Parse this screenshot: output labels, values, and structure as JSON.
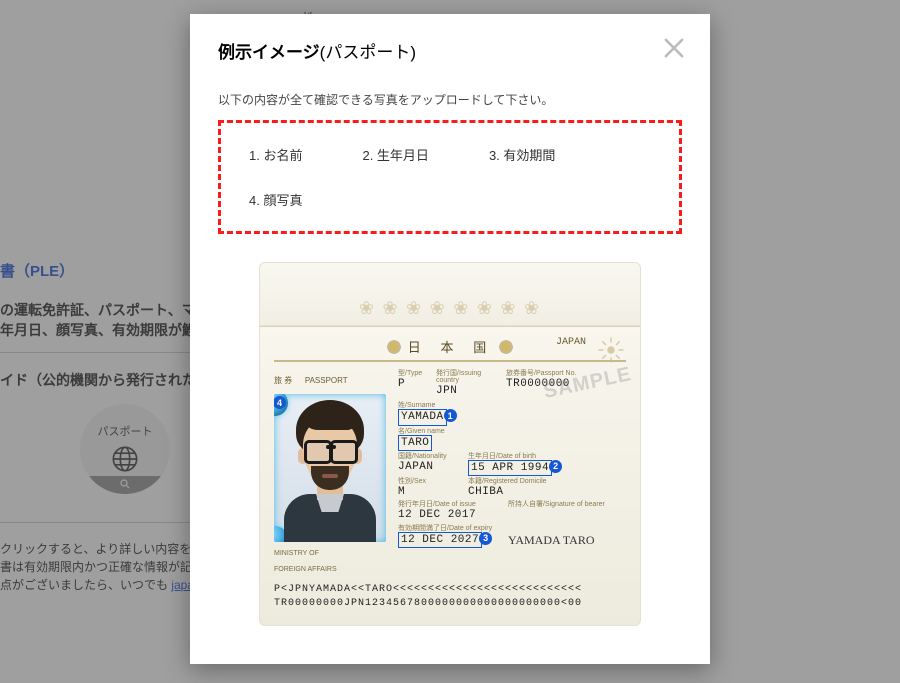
{
  "background": {
    "stock_label": "株",
    "ple_heading": "書（PLE）",
    "line1": "の運転免許証、パスポート、マ",
    "line2": "年月日、顔写真、有効期限が鯉",
    "guide": "イド（公的機関から発行された誰",
    "circle_label": "パスポート",
    "note1": "クリックすると、より詳しい内容を確認することが",
    "note2": "書は有効期限内かつ正確な情報が記載さ",
    "note3_prefix": "点がございましたら、いつでも ",
    "note3_link": "japan.support@"
  },
  "modal": {
    "title_bold": "例示イメージ",
    "title_rest": "(パスポート)",
    "subtitle": "以下の内容が全て確認できる写真をアップロードして下さい。",
    "items": [
      "1. お名前",
      "2. 生年月日",
      "3. 有効期間",
      "4. 顔写真"
    ]
  },
  "passport": {
    "top_travel": "旅 券",
    "top_passport": "PASSPORT",
    "header_kanji": "日 本 国",
    "header_japan": "JAPAN",
    "type_label": "型/Type",
    "type": "P",
    "country_label": "発行国/Issuing country",
    "country_code": "JPN",
    "passno_label": "旅券番号/Passport No.",
    "passno": "TR0000000",
    "surname_label": "姓/Surname",
    "surname": "YAMADA",
    "given_label": "名/Given name",
    "given": "TARO",
    "nationality_label": "国籍/Nationality",
    "nationality": "JAPAN",
    "dob_label": "生年月日/Date of birth",
    "dob": "15 APR 1994",
    "sex_label": "性別/Sex",
    "sex": "M",
    "registered_label": "本籍/Registered Domicile",
    "registered": "CHIBA",
    "issue_label": "発行年月日/Date of issue",
    "issue": "12 DEC 2017",
    "expiry_label": "有効期間満了日/Date of expiry",
    "expiry": "12 DEC 2027",
    "sig_label": "所持人自署/Signature of bearer",
    "signature": "YAMADA TARO",
    "ministry1": "MINISTRY OF",
    "ministry2": "FOREIGN AFFAIRS",
    "mrz1": "P<JPNYAMADA<<TARO<<<<<<<<<<<<<<<<<<<<<<<<<<<",
    "mrz2": "TR00000000JPN1234567800000000000000000000<00",
    "sample": "SAMPLE",
    "badges": {
      "surname": "1",
      "dob": "2",
      "expiry": "3",
      "photo": "4"
    }
  }
}
